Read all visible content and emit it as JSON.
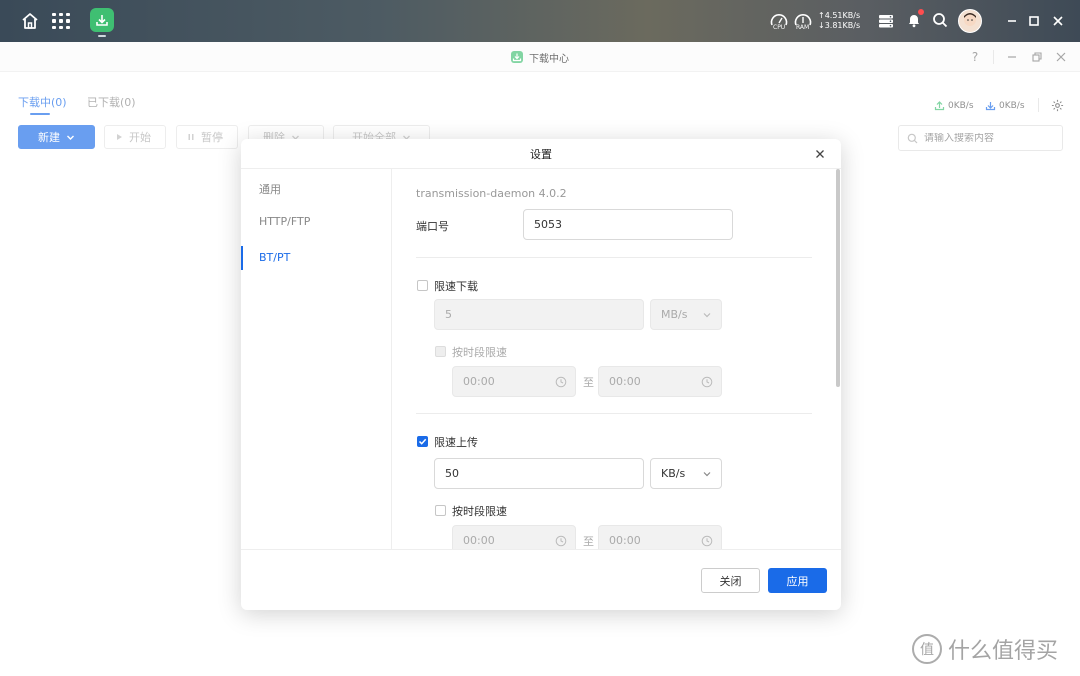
{
  "topbar": {
    "cpu_label": "CPU",
    "ram_label": "RAM",
    "upload_speed": "↑4.51KB/s",
    "download_speed": "↓3.81KB/s"
  },
  "window": {
    "title": "下载中心",
    "help": "?",
    "tabs": [
      {
        "label": "下载中(0)",
        "active": true
      },
      {
        "label": "已下载(0)",
        "active": false
      }
    ],
    "upload_rate": "0KB/s",
    "download_rate": "0KB/s",
    "toolbar": {
      "new_label": "新建",
      "start_label": "开始",
      "pause_label": "暂停",
      "delete_label": "删除",
      "start_all_label": "开始全部"
    },
    "search_placeholder": "请输入搜索内容"
  },
  "modal": {
    "title": "设置",
    "sidebar": [
      "通用",
      "HTTP/FTP",
      "BT/PT"
    ],
    "active_section": "BT/PT",
    "version": "transmission-daemon 4.0.2",
    "port_label": "端口号",
    "port_value": "5053",
    "limit_download": {
      "label": "限速下载",
      "checked": false,
      "value": "5",
      "unit": "MB/s",
      "schedule_label": "按时段限速",
      "schedule_checked": false,
      "from": "00:00",
      "to_label": "至",
      "to": "00:00"
    },
    "limit_upload": {
      "label": "限速上传",
      "checked": true,
      "value": "50",
      "unit": "KB/s",
      "schedule_label": "按时段限速",
      "schedule_checked": false,
      "from": "00:00",
      "to_label": "至",
      "to": "00:00"
    },
    "close_label": "关闭",
    "apply_label": "应用"
  },
  "watermark": "什么值得买",
  "colors": {
    "accent": "#1a6be8",
    "app_green": "#3fbf72"
  }
}
